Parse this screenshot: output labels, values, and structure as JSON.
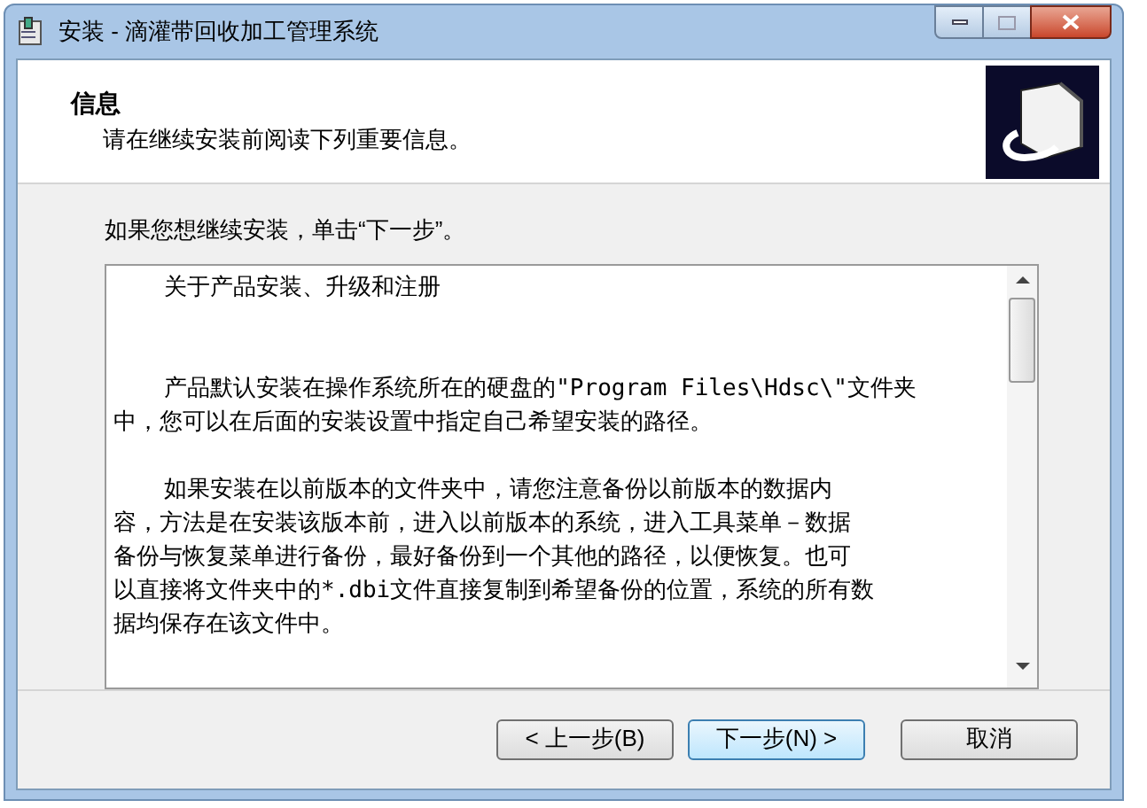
{
  "window": {
    "title": "安装 - 滴灌带回收加工管理系统"
  },
  "header": {
    "title": "信息",
    "subtitle": "请在继续安装前阅读下列重要信息。"
  },
  "instruction": "如果您想继续安装，单击“下一步”。",
  "memo": {
    "paragraphs": [
      {
        "lines": [
          "关于产品安装、升级和注册"
        ]
      },
      {
        "lines": [
          "产品默认安装在操作系统所在的硬盘的\"Program Files\\Hdsc\\\"文件夹",
          "中，您可以在后面的安装设置中指定自己希望安装的路径。"
        ]
      },
      {
        "lines": [
          "如果安装在以前版本的文件夹中，请您注意备份以前版本的数据内",
          "容，方法是在安装该版本前，进入以前版本的系统，进入工具菜单－数据",
          "备份与恢复菜单进行备份，最好备份到一个其他的路径，以便恢复。也可",
          "以直接将文件夹中的*.dbi文件直接复制到希望备份的位置，系统的所有数",
          "据均保存在该文件中。"
        ]
      }
    ]
  },
  "buttons": [
    {
      "label": "< 上一步(B)",
      "selected": false
    },
    {
      "label": "下一步(N) >",
      "selected": true
    },
    {
      "label": "取消",
      "selected": false
    }
  ]
}
